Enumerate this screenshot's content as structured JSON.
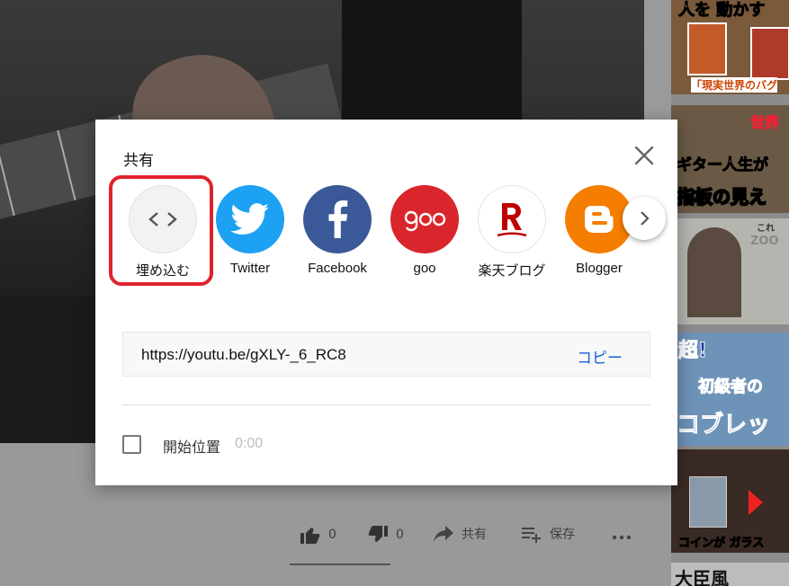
{
  "dialog": {
    "title": "共有",
    "share_targets": [
      {
        "label": "埋め込む",
        "icon": "embed-code-icon",
        "color": "#f2f2f2"
      },
      {
        "label": "Twitter",
        "icon": "twitter-bird-icon",
        "color": "#1da1f2"
      },
      {
        "label": "Facebook",
        "icon": "facebook-f-icon",
        "color": "#3b5998"
      },
      {
        "label": "goo",
        "icon": "goo-logo-icon",
        "color": "#d9252c"
      },
      {
        "label": "楽天ブログ",
        "icon": "rakuten-r-icon",
        "color": "#ffffff"
      },
      {
        "label": "Blogger",
        "icon": "blogger-b-icon",
        "color": "#f57d00"
      }
    ],
    "highlight_color": "#e0222b",
    "url": "https://youtu.be/gXLY-_6_RC8",
    "copy_label": "コピー",
    "start_at_label": "開始位置",
    "start_at_time": "0:00",
    "start_at_checked": false
  },
  "actions": {
    "like_count": "0",
    "dislike_count": "0",
    "share_label": "共有",
    "save_label": "保存"
  },
  "sidebar": {
    "thumb_captions": [
      "人を 動かす",
      "「現実世界のバグ",
      "世界",
      "ギター人生が",
      "指板の見え",
      "これ",
      "ZOO",
      "超!",
      "初級者の",
      "コブレッ",
      "コインが ガラス",
      "大臣風"
    ]
  }
}
